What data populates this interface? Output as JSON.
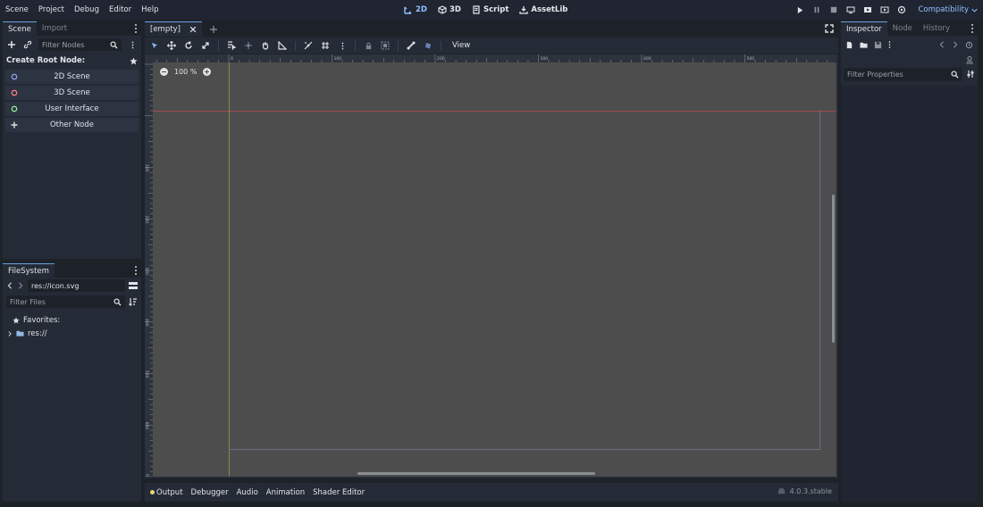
{
  "menu": {
    "items": [
      "Scene",
      "Project",
      "Debug",
      "Editor",
      "Help"
    ]
  },
  "workspaces": [
    {
      "label": "2D",
      "icon": "2d-icon",
      "active": true
    },
    {
      "label": "3D",
      "icon": "3d-icon",
      "active": false
    },
    {
      "label": "Script",
      "icon": "script-icon",
      "active": false
    },
    {
      "label": "AssetLib",
      "icon": "assetlib-icon",
      "active": false
    }
  ],
  "renderer": {
    "label": "Compatibility"
  },
  "scene_dock": {
    "tabs": [
      "Scene",
      "Import"
    ],
    "filter_placeholder": "Filter Nodes",
    "create_root_label": "Create Root Node:",
    "root_buttons": [
      {
        "label": "2D Scene",
        "color": "#8da5f3"
      },
      {
        "label": "3D Scene",
        "color": "#fc7f7f"
      },
      {
        "label": "User Interface",
        "color": "#8eef97"
      },
      {
        "label": "Other Node",
        "color": "#e0e0e0"
      }
    ]
  },
  "filesystem": {
    "tab": "FileSystem",
    "path": "res://icon.svg",
    "filter_placeholder": "Filter Files",
    "favorites_label": "Favorites:",
    "root_label": "res://"
  },
  "editor": {
    "scene_tab": "[empty]",
    "view_label": "View",
    "zoom_label": "100 %",
    "ruler_labels": [
      "100",
      "0",
      "100",
      "200",
      "300",
      "400",
      "500",
      "600",
      "700",
      "800",
      "900",
      "1000",
      "1100"
    ],
    "ruler_v_labels": [
      "100",
      "200",
      "300",
      "400",
      "500",
      "600",
      "700"
    ]
  },
  "bottom_panel": {
    "tabs": [
      "Output",
      "Debugger",
      "Audio",
      "Animation",
      "Shader Editor"
    ],
    "version": "4.0.3.stable"
  },
  "inspector": {
    "tabs": [
      "Inspector",
      "Node",
      "History"
    ],
    "filter_placeholder": "Filter Properties"
  },
  "colors": {
    "accent": "#8fc0ff",
    "axis_x": "#a14a50",
    "axis_y": "#7b8f4a",
    "canvas": "#4d4d4d"
  }
}
